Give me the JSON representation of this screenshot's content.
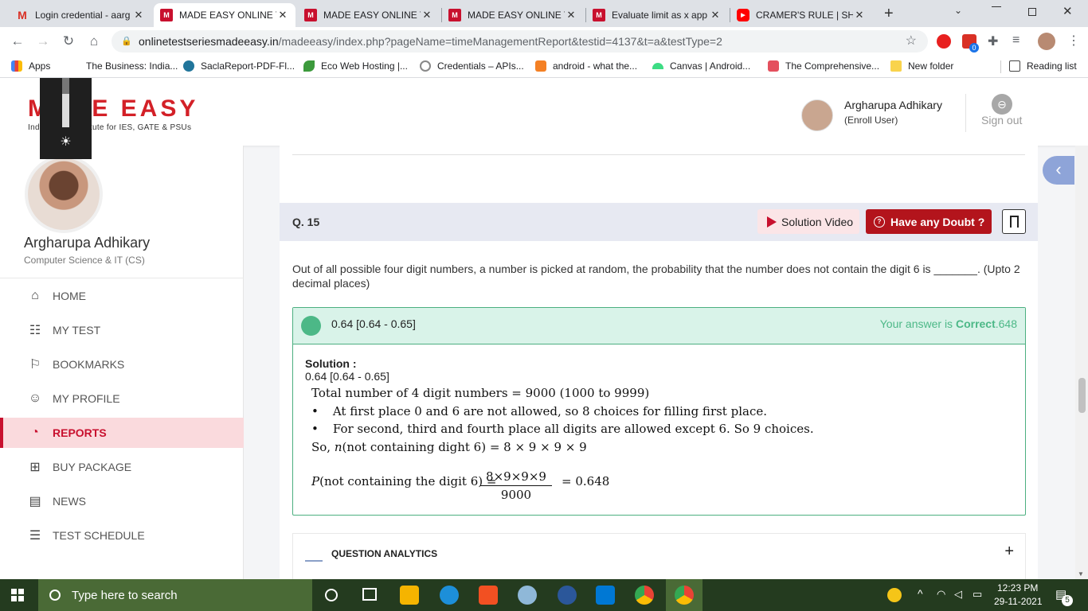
{
  "browser": {
    "tabs": [
      {
        "title": "Login credential - aarg",
        "icon": "gmail-icon",
        "color": "#d93025"
      },
      {
        "title": "MADE EASY ONLINE T",
        "icon": "madeeasy-icon",
        "color": "#c8102e",
        "active": true
      },
      {
        "title": "MADE EASY ONLINE T",
        "icon": "madeeasy-icon",
        "color": "#c8102e"
      },
      {
        "title": "MADE EASY ONLINE T",
        "icon": "madeeasy-icon",
        "color": "#c8102e"
      },
      {
        "title": "Evaluate limit as x app",
        "icon": "m-icon",
        "color": "#c8102e"
      },
      {
        "title": "CRAMER'S RULE | SHC",
        "icon": "youtube-icon",
        "color": "#ff0000"
      }
    ],
    "url_domain": "onlinetestseriesmadeeasy.in",
    "url_path": "/madeeasy/index.php?pageName=timeManagementReport&testid=4137&t=a&testType=2",
    "extension_badge": "0",
    "bookmarks": [
      {
        "label": "Apps",
        "icon": "apps-grid-icon"
      },
      {
        "label": "The Business: India...",
        "icon": "bookmark-icon"
      },
      {
        "label": "SaclaReport-PDF-Fl...",
        "icon": "wordpress-icon"
      },
      {
        "label": "Eco Web Hosting |...",
        "icon": "leaf-icon"
      },
      {
        "label": "Credentials – APIs...",
        "icon": "gear-icon"
      },
      {
        "label": "android - what the...",
        "icon": "stackoverflow-icon"
      },
      {
        "label": "Canvas | Android...",
        "icon": "android-icon"
      },
      {
        "label": "The Comprehensive...",
        "icon": "udacity-icon"
      },
      {
        "label": "New folder",
        "icon": "folder-icon"
      }
    ],
    "reading_list": "Reading list"
  },
  "header": {
    "logo_text": "MADE EASY",
    "logo_tagline": "India's Best Institute for IES, GATE & PSUs",
    "user_name": "Argharupa Adhikary",
    "user_role": "(Enroll User)",
    "signout_label": "Sign out"
  },
  "sidebar": {
    "name": "Argharupa Adhikary",
    "dept": "Computer Science & IT (CS)",
    "items": [
      {
        "label": "HOME",
        "icon": "home-icon"
      },
      {
        "label": "MY TEST",
        "icon": "test-icon"
      },
      {
        "label": "BOOKMARKS",
        "icon": "bookmark-icon"
      },
      {
        "label": "MY PROFILE",
        "icon": "profile-icon"
      },
      {
        "label": "REPORTS",
        "icon": "reports-icon",
        "active": true
      },
      {
        "label": "BUY PACKAGE",
        "icon": "cart-icon"
      },
      {
        "label": "NEWS",
        "icon": "news-icon"
      },
      {
        "label": "TEST SCHEDULE",
        "icon": "schedule-icon"
      }
    ]
  },
  "question": {
    "number": "Q. 15",
    "solution_video_label": "Solution Video",
    "doubt_label": "Have any Doubt ?",
    "text": "Out of all possible four digit numbers, a number is picked at random, the probability that the number does not contain the digit 6 is _______. (Upto 2 decimal places)",
    "answer": "0.64 [0.64 - 0.65]",
    "verdict_prefix": "Your answer is ",
    "verdict_word": "Correct",
    "verdict_value": ".648",
    "solution_title": "Solution :",
    "solution_answer": "0.64 [0.64 - 0.65]",
    "lines": {
      "l1": "Total number of 4 digit numbers = 9000 (1000 to 9999)",
      "l2": "At first place 0 and 6 are not allowed, so 8 choices for filling first place.",
      "l3": "For second, third and fourth place all digits are allowed except 6. So 9 choices.",
      "l4_pre": "So, ",
      "l4_var": "n",
      "l4_post": "(not containing dight 6) = 8 × 9 × 9 × 9",
      "p_var": "P",
      "p_label": "(not containing the digit  6) =",
      "numerator": "8×9×9×9",
      "denominator": "9000",
      "result": "= 0.648",
      "bullet": "•"
    },
    "analytics_label": "QUESTION ANALYTICS",
    "analytics_toggle": "+"
  },
  "taskbar": {
    "search_placeholder": "Type here to search",
    "time": "12:23 PM",
    "date": "29-11-2021",
    "notif_count": "5"
  }
}
